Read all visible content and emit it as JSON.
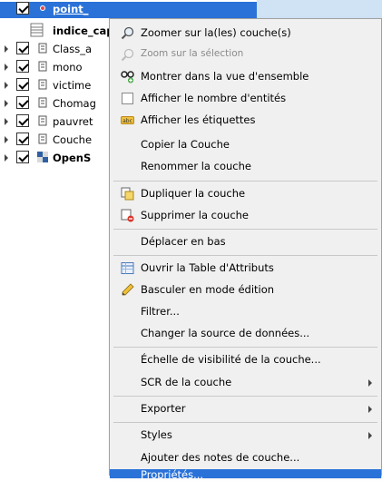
{
  "layers": [
    {
      "name": "point_",
      "style": "selected",
      "icon": "point-layer-icon"
    },
    {
      "name": "indice_cap",
      "style": "bold-table",
      "icon": "table-layer-icon"
    },
    {
      "name": "Class_a",
      "style": "normal",
      "icon": "polygon-layer-icon"
    },
    {
      "name": "mono",
      "style": "normal",
      "icon": "polygon-layer-icon"
    },
    {
      "name": "victime",
      "style": "normal",
      "icon": "polygon-layer-icon"
    },
    {
      "name": "Chomag",
      "style": "normal",
      "icon": "polygon-layer-icon"
    },
    {
      "name": "pauvret",
      "style": "normal",
      "icon": "polygon-layer-icon"
    },
    {
      "name": "Couche",
      "style": "normal",
      "icon": "polygon-layer-icon"
    },
    {
      "name": "OpenS",
      "style": "bold",
      "icon": "osm-layer-icon"
    }
  ],
  "menu": {
    "zoom_layer": "Zoomer sur la(les) couche(s)",
    "zoom_selection": "Zoom sur la sélection",
    "show_overview": "Montrer dans la vue d'ensemble",
    "show_feature_count": "Afficher le nombre d'entités",
    "show_labels": "Afficher les étiquettes",
    "copy_layer": "Copier la Couche",
    "rename_layer": "Renommer la couche",
    "duplicate_layer": "Dupliquer la couche",
    "remove_layer": "Supprimer la couche",
    "move_bottom": "Déplacer en bas",
    "open_attribute_table": "Ouvrir la Table d'Attributs",
    "toggle_editing": "Basculer en mode édition",
    "filter": "Filtrer...",
    "change_source": "Changer la source de données...",
    "visibility_scale": "Échelle de visibilité de la couche...",
    "layer_crs": "SCR de la couche",
    "export": "Exporter",
    "styles": "Styles",
    "add_notes": "Ajouter des notes de couche...",
    "properties": "Propriétés..."
  },
  "colors": {
    "selection": "#2a72d8",
    "menu_bg": "#f0f0f0"
  }
}
